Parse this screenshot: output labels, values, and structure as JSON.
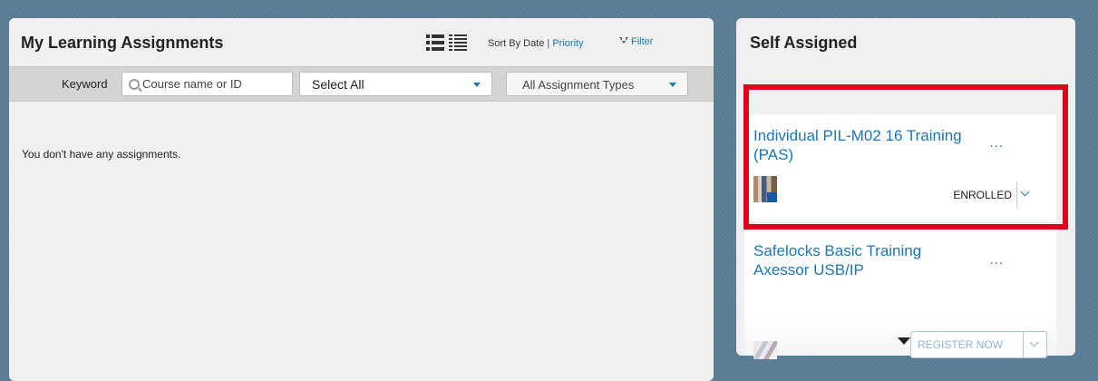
{
  "my_learning": {
    "title": "My Learning Assignments",
    "sort_label": "Sort By Date",
    "sort_separator": "|",
    "sort_priority": "Priority",
    "filter_label": "Filter",
    "keyword_label": "Keyword",
    "search_placeholder": "Course name or ID",
    "select_all": "Select All",
    "assignment_types": "All Assignment Types",
    "empty_message": "You don't have any assignments."
  },
  "self_assigned": {
    "title": "Self Assigned",
    "courses": [
      {
        "title": "Individual PIL-M02 16 Training (PAS)",
        "more": "...",
        "status": "ENROLLED",
        "highlighted": true
      },
      {
        "title": "Safelocks Basic Training Axessor USB/IP",
        "more": "...",
        "action": "REGISTER NOW"
      }
    ]
  },
  "colors": {
    "link": "#1a76b8",
    "highlight": "#e0001b",
    "background": "#5a7d96"
  },
  "icons": [
    "list-view-icon",
    "compact-list-view-icon",
    "filter-icon",
    "search-icon",
    "chevron-down-icon",
    "scroll-down-arrow-icon"
  ]
}
